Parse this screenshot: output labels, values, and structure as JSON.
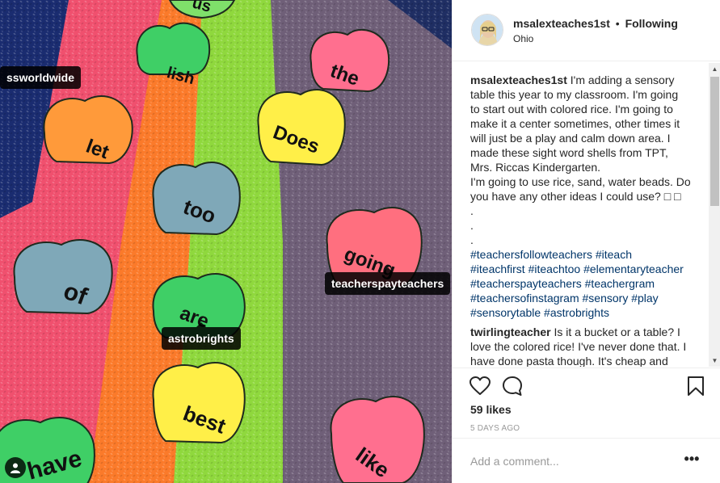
{
  "photo": {
    "shells": [
      {
        "word": "us",
        "color": "#7fe06a"
      },
      {
        "word": "lish",
        "color": "#3fcf66"
      },
      {
        "word": "the",
        "color": "#ff6f8f"
      },
      {
        "word": "let",
        "color": "#ff9a3a"
      },
      {
        "word": "Does",
        "color": "#ffef48"
      },
      {
        "word": "too",
        "color": "#7fa8b8"
      },
      {
        "word": "of",
        "color": "#7fa8b8"
      },
      {
        "word": "going",
        "color": "#ff6f7f"
      },
      {
        "word": "are",
        "color": "#3fcf66"
      },
      {
        "word": "best",
        "color": "#ffef48"
      },
      {
        "word": "have",
        "color": "#3fcf66"
      },
      {
        "word": "like",
        "color": "#ff6f8f"
      }
    ],
    "tags": {
      "ss": "ssworldwide",
      "tpt": "teacherspayteachers",
      "astro": "astrobrights"
    }
  },
  "header": {
    "username": "msalexteaches1st",
    "separator": "•",
    "follow_status": "Following",
    "location": "Ohio"
  },
  "post": {
    "author": "msalexteaches1st",
    "caption_lines": [
      "I'm adding a sensory",
      "table this year to my classroom. I'm going",
      "to start out with colored rice. I'm going to",
      "make it a center sometimes, other times it",
      "will just be a play and calm down area. I",
      "made these sight word shells from TPT,",
      "Mrs. Riccas Kindergarten.",
      "I'm going to use rice, sand, water beads. Do",
      "you have any other ideas I could use? □ □",
      ".",
      ".",
      "."
    ],
    "hashtag_lines": [
      "#teachersfollowteachers #iteach",
      "#iteachfirst #iteachtoo #elementaryteacher",
      "#teacherspayteachers #teachergram",
      "#teachersofinstagram #sensory #play",
      "#sensorytable #astrobrights"
    ]
  },
  "comments": [
    {
      "user": "twirlingteacher",
      "lines": [
        "Is it a bucket or a table? I",
        "love the colored rice! I've never done that. I",
        "have done pasta though. It's cheap and"
      ]
    }
  ],
  "actions": {
    "likes": "59 likes",
    "date": "5 DAYS AGO"
  },
  "add_comment": {
    "placeholder": "Add a comment...",
    "more": "•••"
  },
  "colors": {
    "link": "#003569",
    "muted": "#999999",
    "border": "#efefef"
  }
}
